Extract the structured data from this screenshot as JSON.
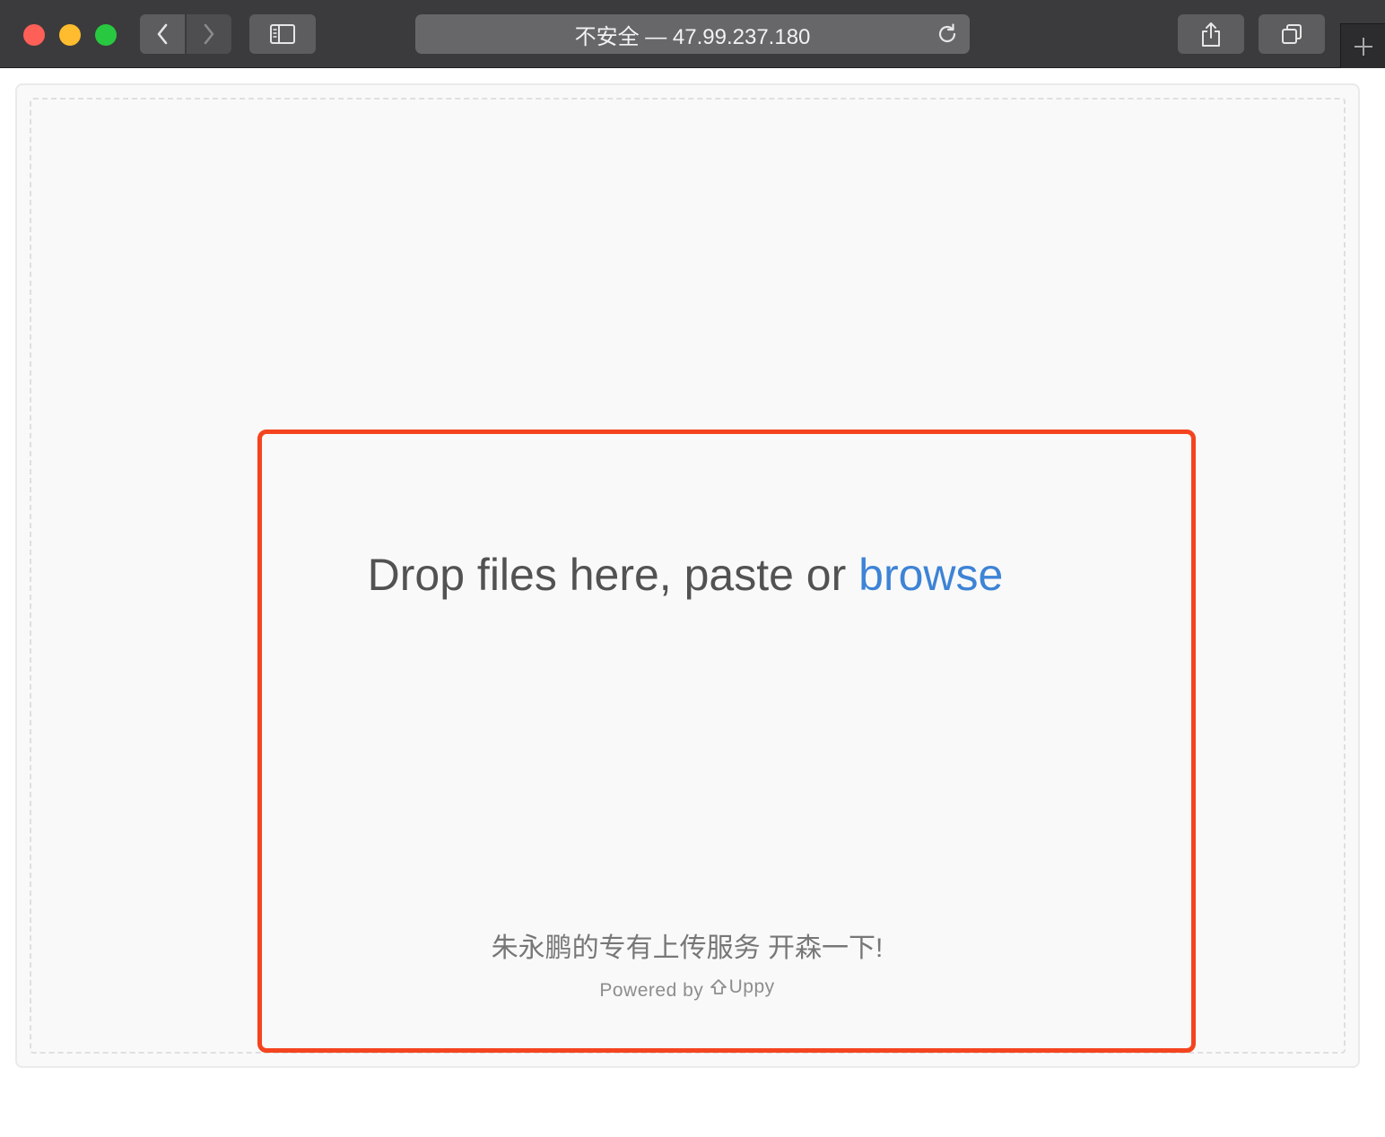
{
  "browser": {
    "address_text": "不安全 — 47.99.237.180",
    "icons": [
      "back-icon",
      "forward-icon",
      "sidebar-icon",
      "reload-icon",
      "share-icon",
      "tabs-icon",
      "plus-icon"
    ]
  },
  "dashboard": {
    "drop_prefix": "Drop files here, paste or ",
    "browse_label": "browse",
    "note": "朱永鹏的专有上传服务 开森一下!",
    "powered_by": "Powered by ",
    "brand": "Uppy"
  },
  "colors": {
    "accent": "#3d83d6",
    "highlight": "#f4441f",
    "toolbar": "#3b3b3d"
  }
}
